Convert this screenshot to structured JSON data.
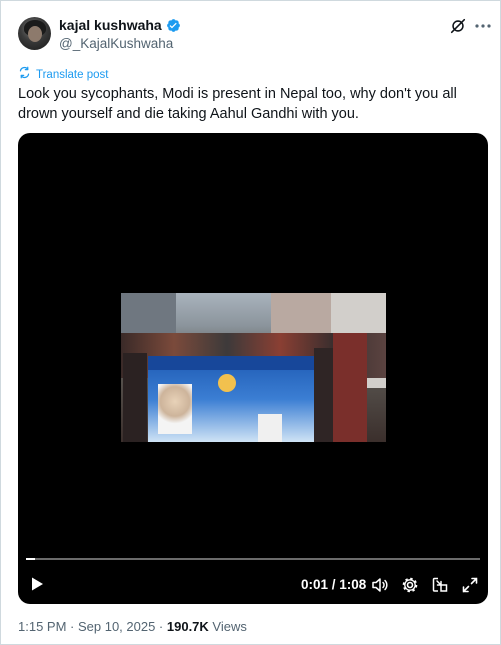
{
  "author": {
    "display_name": "kajal kushwaha",
    "handle": "@_KajalKushwaha",
    "verified": true
  },
  "header_icons": [
    "grok-icon",
    "more-icon"
  ],
  "translate_label": "Translate post",
  "tweet_text": "Look you sycophants, Modi is present in Nepal too, why don't you all drown yourself and die taking Aahul Gandhi with you.",
  "video": {
    "time_display": "0:01 / 1:08",
    "progress": 0.02,
    "controls": [
      "play-icon",
      "volume-icon",
      "settings-icon",
      "picture-in-picture-icon",
      "fullscreen-icon"
    ]
  },
  "meta": {
    "timestamp": "1:15 PM · Sep 10, 2025",
    "separator": " · ",
    "views_count": "190.7K",
    "views_label": " Views"
  },
  "colors": {
    "accent": "#1d9bf0",
    "secondary_text": "#536471",
    "primary_text": "#0f1419",
    "video_bg": "#000000"
  }
}
